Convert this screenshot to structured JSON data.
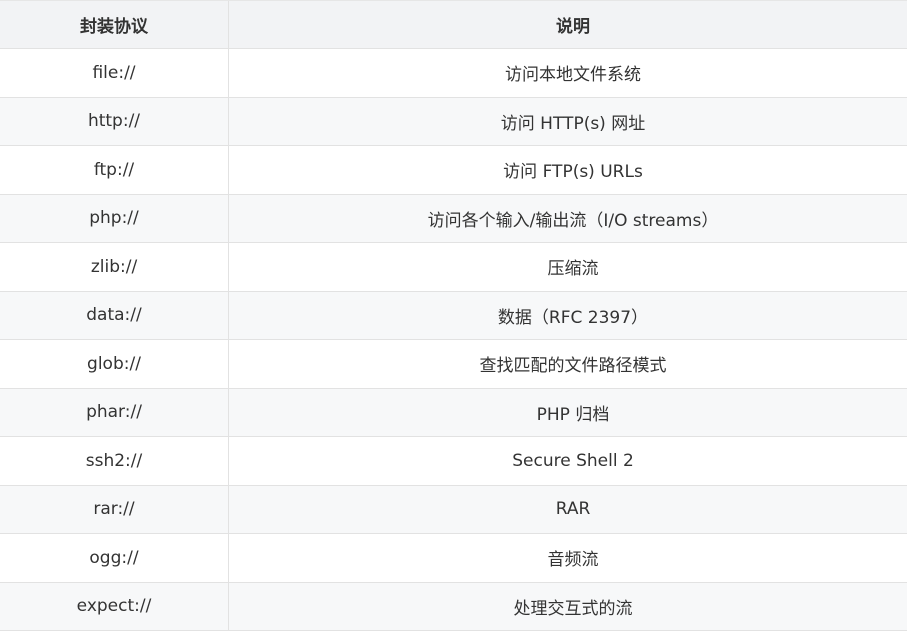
{
  "table": {
    "headers": [
      "封装协议",
      "说明"
    ],
    "rows": [
      {
        "protocol": "file://",
        "description": "访问本地文件系统"
      },
      {
        "protocol": "http://",
        "description": "访问 HTTP(s) 网址"
      },
      {
        "protocol": "ftp://",
        "description": "访问 FTP(s) URLs"
      },
      {
        "protocol": "php://",
        "description": "访问各个输入/输出流（I/O streams）"
      },
      {
        "protocol": "zlib://",
        "description": "压缩流"
      },
      {
        "protocol": "data://",
        "description": "数据（RFC 2397）"
      },
      {
        "protocol": "glob://",
        "description": "查找匹配的文件路径模式"
      },
      {
        "protocol": "phar://",
        "description": "PHP 归档"
      },
      {
        "protocol": "ssh2://",
        "description": "Secure Shell 2"
      },
      {
        "protocol": "rar://",
        "description": "RAR"
      },
      {
        "protocol": "ogg://",
        "description": "音频流"
      },
      {
        "protocol": "expect://",
        "description": "处理交互式的流"
      }
    ]
  }
}
